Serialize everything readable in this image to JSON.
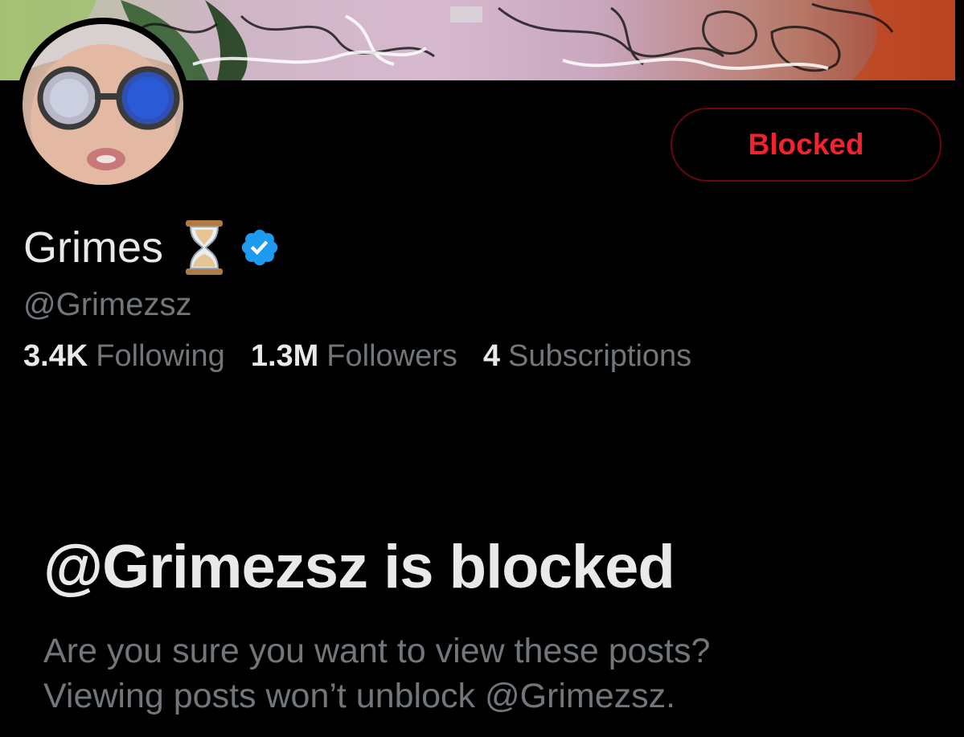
{
  "profile": {
    "display_name": "Grimes",
    "handle": "@Grimezsz",
    "blocked_button_label": "Blocked"
  },
  "stats": [
    {
      "value": "3.4K",
      "label": "Following"
    },
    {
      "value": "1.3M",
      "label": "Followers"
    },
    {
      "value": "4",
      "label": "Subscriptions"
    }
  ],
  "blocked_notice": {
    "title": "@Grimezsz is blocked",
    "line1": "Are you sure you want to view these posts?",
    "line2": "Viewing posts won’t unblock @Grimezsz."
  },
  "icons": {
    "name_emoji": "hourglass-icon",
    "verified_badge": "verified-badge-icon"
  },
  "colors": {
    "background": "#000000",
    "primary_text": "#e7e9ea",
    "secondary_text": "#71767b",
    "blocked_red": "#f4212e",
    "blocked_border": "#67070f",
    "verified_blue": "#1d9bf0"
  }
}
